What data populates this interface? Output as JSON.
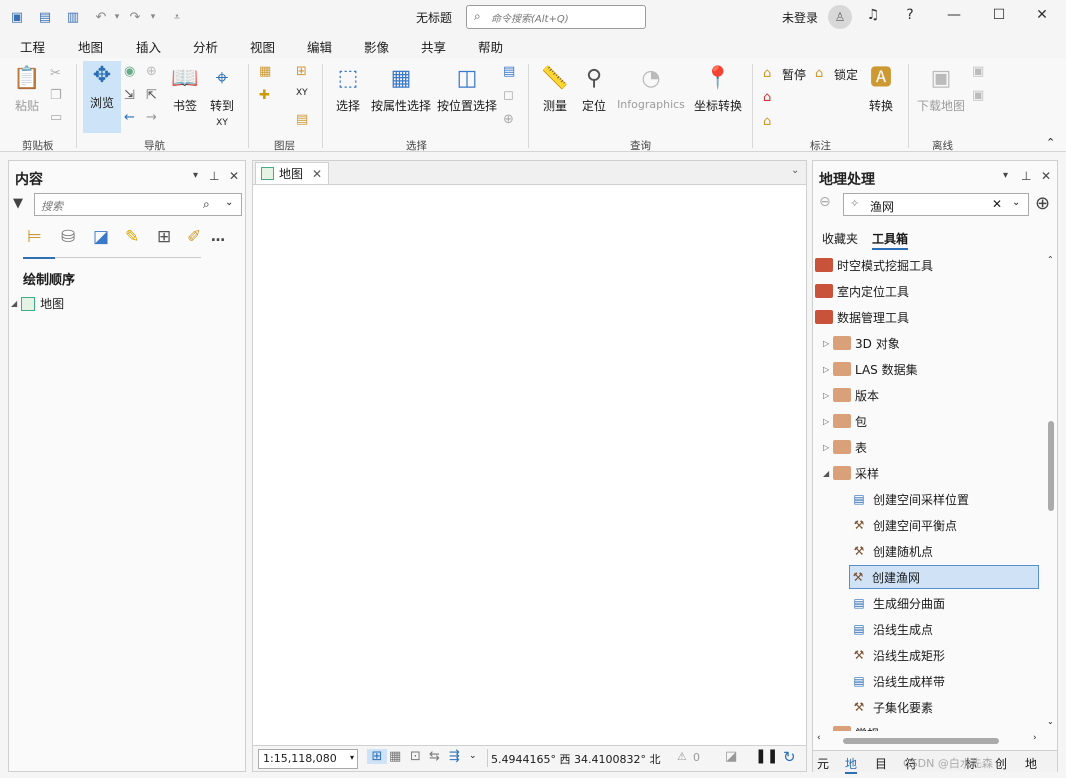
{
  "title": "无标题",
  "search": {
    "placeholder": "命令搜索(Alt+Q)"
  },
  "account": {
    "login": "未登录"
  },
  "tabs": [
    "工程",
    "地图",
    "插入",
    "分析",
    "视图",
    "编辑",
    "影像",
    "共享",
    "帮助"
  ],
  "ribbon": {
    "paste": "粘贴",
    "clipboard": "剪贴板",
    "browse": "浏览",
    "bookmark": "书签",
    "goto": "转到",
    "goto_xy": "XY",
    "nav": "导航",
    "layers": "图层",
    "select": "选择",
    "select_attr": "按属性选择",
    "select_loc": "按位置选择",
    "selection": "选择",
    "measure": "测量",
    "locate": "定位",
    "infographics": "Infographics",
    "coord": "坐标转换",
    "query": "查询",
    "pause": "暂停",
    "lock": "锁定",
    "convert": "转换",
    "annotate": "标注",
    "download": "下载地图",
    "offline": "离线"
  },
  "contents": {
    "title": "内容",
    "search_placeholder": "搜索",
    "section": "绘制顺序",
    "map_item": "地图"
  },
  "map": {
    "tab": "地图",
    "scale": "1:15,118,080",
    "coords": "5.4944165° 西 34.4100832° 北",
    "warn": "0"
  },
  "geoprocessing": {
    "title": "地理处理",
    "search_value": "渔网",
    "tab_fav": "收藏夹",
    "tab_toolbox": "工具箱",
    "items": [
      {
        "label": "时空模式挖掘工具",
        "kind": "box",
        "level": 0
      },
      {
        "label": "室内定位工具",
        "kind": "box",
        "level": 0
      },
      {
        "label": "数据管理工具",
        "kind": "box",
        "level": 0
      },
      {
        "label": "3D 对象",
        "kind": "set",
        "level": 1
      },
      {
        "label": "LAS 数据集",
        "kind": "set",
        "level": 1
      },
      {
        "label": "版本",
        "kind": "set",
        "level": 1
      },
      {
        "label": "包",
        "kind": "set",
        "level": 1
      },
      {
        "label": "表",
        "kind": "set",
        "level": 1
      },
      {
        "label": "采样",
        "kind": "set-open",
        "level": 1
      },
      {
        "label": "创建空间采样位置",
        "kind": "script",
        "level": 2
      },
      {
        "label": "创建空间平衡点",
        "kind": "tool",
        "level": 2
      },
      {
        "label": "创建随机点",
        "kind": "tool",
        "level": 2
      },
      {
        "label": "创建渔网",
        "kind": "tool",
        "level": 2,
        "selected": true
      },
      {
        "label": "生成细分曲面",
        "kind": "script",
        "level": 2
      },
      {
        "label": "沿线生成点",
        "kind": "script",
        "level": 2
      },
      {
        "label": "沿线生成矩形",
        "kind": "tool",
        "level": 2
      },
      {
        "label": "沿线生成样带",
        "kind": "script",
        "level": 2
      },
      {
        "label": "子集化要素",
        "kind": "tool",
        "level": 2
      },
      {
        "label": "常规",
        "kind": "set",
        "level": 1
      }
    ],
    "bottom_tabs": [
      "元",
      "地",
      "目",
      "符",
      "标",
      "创",
      "地"
    ],
    "watermark": "CSDN @白水先森"
  }
}
